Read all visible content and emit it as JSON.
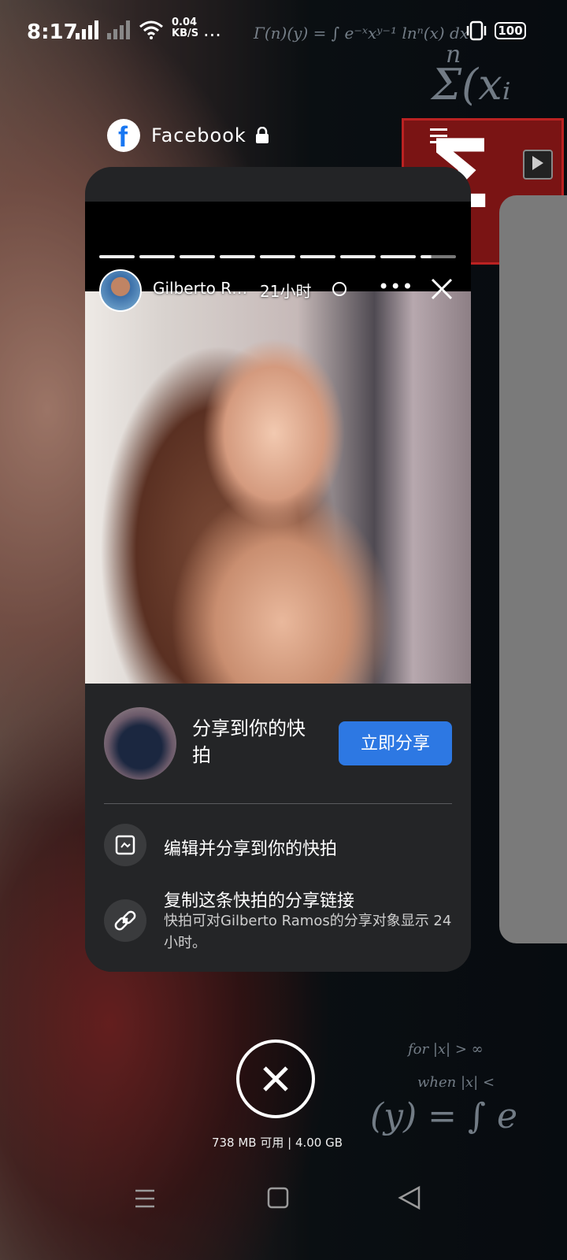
{
  "status_bar": {
    "time": "8:17",
    "net_speed_value": "0.04",
    "net_speed_unit": "KB/S",
    "more": "...",
    "battery": "100"
  },
  "app": {
    "title": "Facebook"
  },
  "story": {
    "user_name": "Gilberto R…",
    "time_ago": "21小时",
    "progress_segments": 9
  },
  "share_sheet": {
    "share_prompt": "分享到你的快拍",
    "share_button": "立即分享",
    "option_edit": "编辑并分享到你的快拍",
    "option_copy": "复制这条快拍的分享链接",
    "option_copy_sub": "快拍可对Gilberto Ramos的分享对象显示 24 小时。"
  },
  "recents": {
    "memory": "738 MB 可用 | 4.00 GB"
  },
  "background_math": {
    "gamma": "Γ(n)(y) = ∫ e⁻ˣxʸ⁻¹ lnⁿ(x) dx",
    "sum": "Σ(xᵢ",
    "n": "n",
    "for1": "for |x| > ∞",
    "for2": "when |x| <",
    "yeq": "(y) = ∫ e"
  },
  "colors": {
    "accent": "#2d78e3",
    "sheet_bg": "#242527",
    "card_bg": "#232426"
  }
}
